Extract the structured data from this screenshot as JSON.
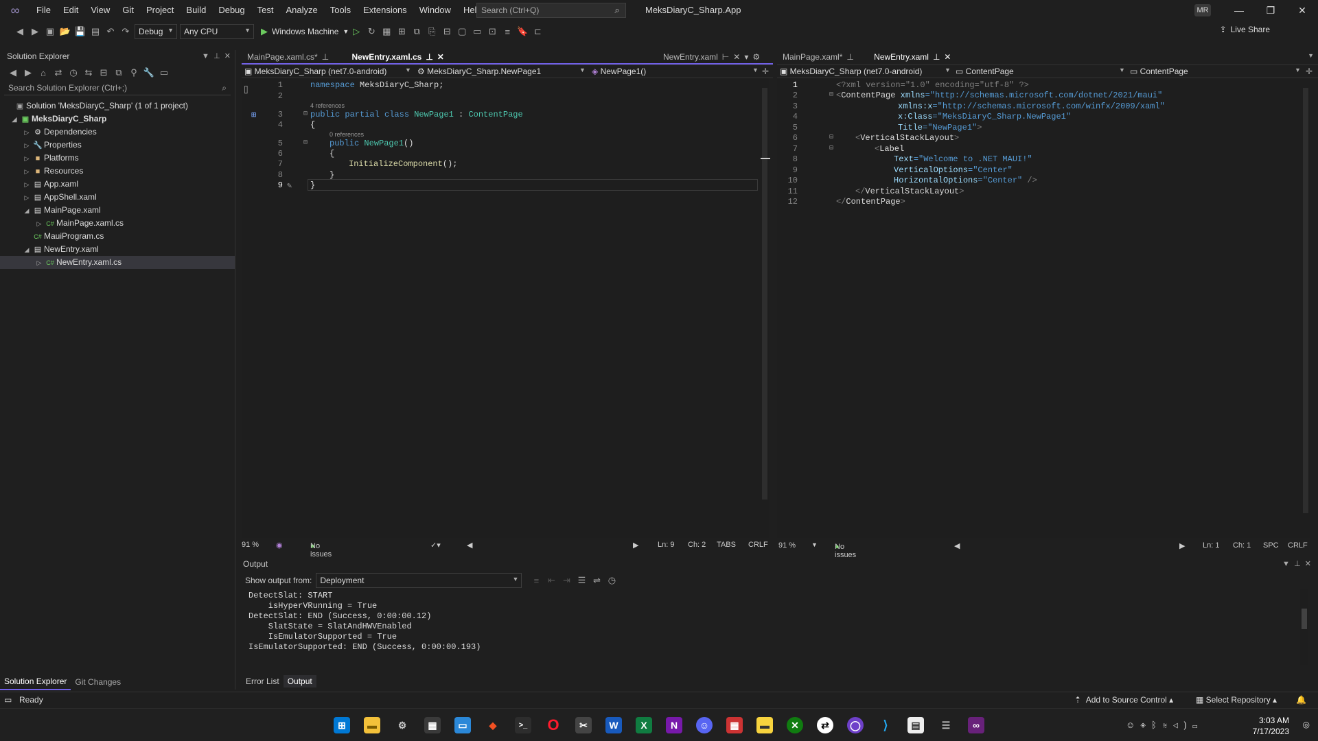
{
  "menu": [
    "File",
    "Edit",
    "View",
    "Git",
    "Project",
    "Build",
    "Debug",
    "Test",
    "Analyze",
    "Tools",
    "Extensions",
    "Window",
    "Help"
  ],
  "search": {
    "placeholder": "Search (Ctrl+Q)"
  },
  "app_title": "MeksDiaryC_Sharp.App",
  "user_initials": "MR",
  "toolbar": {
    "config": "Debug",
    "platform": "Any CPU",
    "run_target": "Windows Machine",
    "live_share": "Live Share"
  },
  "solution_explorer": {
    "title": "Solution Explorer",
    "search_placeholder": "Search Solution Explorer (Ctrl+;)",
    "items": [
      {
        "label": "Solution 'MeksDiaryC_Sharp' (1 of 1 project)"
      },
      {
        "label": "MeksDiaryC_Sharp"
      },
      {
        "label": "Dependencies"
      },
      {
        "label": "Properties"
      },
      {
        "label": "Platforms"
      },
      {
        "label": "Resources"
      },
      {
        "label": "App.xaml"
      },
      {
        "label": "AppShell.xaml"
      },
      {
        "label": "MainPage.xaml"
      },
      {
        "label": "MainPage.xaml.cs"
      },
      {
        "label": "MauiProgram.cs"
      },
      {
        "label": "NewEntry.xaml"
      },
      {
        "label": "NewEntry.xaml.cs"
      }
    ],
    "tabs": [
      "Solution Explorer",
      "Git Changes"
    ]
  },
  "left_editor": {
    "tabs": [
      "MainPage.xaml.cs*",
      "NewEntry.xaml.cs",
      "NewEntry.xaml"
    ],
    "nav": [
      "MeksDiaryC_Sharp (net7.0-android)",
      "MeksDiaryC_Sharp.NewPage1",
      "NewPage1()"
    ],
    "lines": [
      "1",
      "2",
      "3",
      "4",
      "5",
      "6",
      "7",
      "8",
      "9"
    ],
    "refs": [
      "4 references",
      "0 references"
    ],
    "code": {
      "l1a": "namespace",
      "l1b": " MeksDiaryC_Sharp;",
      "l3a": "public partial class ",
      "l3b": "NewPage1",
      "l3c": " : ",
      "l3d": "ContentPage",
      "l4": "{",
      "l5a": "public ",
      "l5b": "NewPage1",
      "l5c": "()",
      "l6": "{",
      "l7a": "InitializeComponent",
      "l7b": "();",
      "l8": "}",
      "l9": "}"
    },
    "status": {
      "zoom": "91 %",
      "issues": "No issues found",
      "ln": "Ln: 9",
      "ch": "Ch: 2",
      "tabs": "TABS",
      "eol": "CRLF"
    }
  },
  "right_editor": {
    "tabs": [
      "MainPage.xaml*",
      "NewEntry.xaml"
    ],
    "nav": [
      "MeksDiaryC_Sharp (net7.0-android)",
      "ContentPage",
      "ContentPage"
    ],
    "lines": [
      "1",
      "2",
      "3",
      "4",
      "5",
      "6",
      "7",
      "8",
      "9",
      "10",
      "11",
      "12"
    ],
    "code": {
      "l1": "<?xml version=\"1.0\" encoding=\"utf-8\" ?>",
      "l2a": "<",
      "l2b": "ContentPage",
      "l2c": " xmlns",
      "l2d": "=\"http://schemas.microsoft.com/dotnet/2021/maui\"",
      "l3a": "xmlns:x",
      "l3b": "=\"http://schemas.microsoft.com/winfx/2009/xaml\"",
      "l4a": "x:Class",
      "l4b": "=\"MeksDiaryC_Sharp.NewPage1\"",
      "l5a": "Title",
      "l5b": "=\"NewPage1\"",
      "l5c": ">",
      "l6a": "<",
      "l6b": "VerticalStackLayout",
      "l6c": ">",
      "l7a": "<",
      "l7b": "Label",
      "l8a": "Text",
      "l8b": "=\"Welcome to .NET MAUI!\"",
      "l9a": "VerticalOptions",
      "l9b": "=\"Center\"",
      "l10a": "HorizontalOptions",
      "l10b": "=\"Center\"",
      "l10c": " />",
      "l11a": "</",
      "l11b": "VerticalStackLayout",
      "l11c": ">",
      "l12a": "</",
      "l12b": "ContentPage",
      "l12c": ">"
    },
    "status": {
      "zoom": "91 %",
      "issues": "No issues found",
      "ln": "Ln: 1",
      "ch": "Ch: 1",
      "tabs": "SPC",
      "eol": "CRLF"
    }
  },
  "output": {
    "title": "Output",
    "show_from_label": "Show output from:",
    "source": "Deployment",
    "text": "DetectSlat: START\n    isHyperVRunning = True\nDetectSlat: END (Success, 0:00:00.12)\n    SlatState = SlatAndHWVEnabled\n    IsEmulatorSupported = True\nIsEmulatorSupported: END (Success, 0:00:00.193)"
  },
  "bottom_tabs": [
    "Error List",
    "Output"
  ],
  "statusbar": {
    "ready": "Ready",
    "source_control": "Add to Source Control",
    "repo": "Select Repository"
  },
  "clock": {
    "time": "3:03 AM",
    "date": "7/17/2023"
  },
  "colors": {
    "accent": "#7160e8",
    "bg": "#1f1f1f",
    "editor": "#1e1e1e",
    "keyword": "#569cd6",
    "type": "#4ec9b0",
    "method": "#dcdcaa",
    "attribute": "#9cdcfe"
  }
}
